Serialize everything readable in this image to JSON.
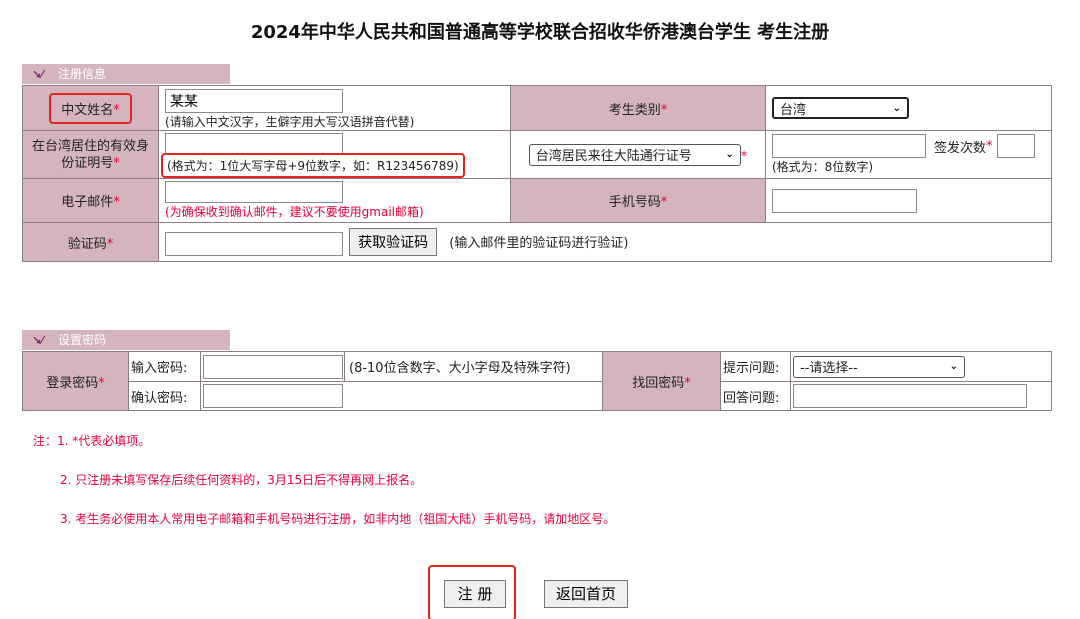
{
  "title": "2024年中华人民共和国普通高等学校联合招收华侨港澳台学生  考生注册",
  "section1": {
    "tab": "注册信息",
    "name_label": "中文姓名",
    "name_value": "某某",
    "name_hint": "(请输入中文汉字，生僻字用大写汉语拼音代替)",
    "category_label": "考生类别",
    "category_value": "台湾",
    "id_label": "在台湾居住的有效身份证明号",
    "id_hint": "(格式为：1位大写字母+9位数字，如：R123456789)",
    "permit_type": "台湾居民来往大陆通行证号",
    "permit_hint": "(格式为：8位数字)",
    "issue_count_label": "签发次数",
    "email_label": "电子邮件",
    "email_hint": "(为确保收到确认邮件，建议不要使用gmail邮箱)",
    "phone_label": "手机号码",
    "code_label": "验证码",
    "code_button": "获取验证码",
    "code_hint": "(输入邮件里的验证码进行验证)",
    "required_mark": "*"
  },
  "section2": {
    "tab": "设置密码",
    "login_pwd_label": "登录密码",
    "enter_pwd_label": "输入密码:",
    "enter_pwd_hint": "(8-10位含数字、大小字母及特殊字符)",
    "confirm_pwd_label": "确认密码:",
    "recover_label": "找回密码",
    "question_label": "提示问题:",
    "question_value": "--请选择--",
    "answer_label": "回答问题:"
  },
  "notes": [
    "注：1. *代表必填项。",
    "2. 只注册未填写保存后续任何资料的，3月15日后不得再网上报名。",
    "3. 考生务必使用本人常用电子邮箱和手机号码进行注册，如非内地（祖国大陆）手机号码，请加地区号。"
  ],
  "buttons": {
    "register": "注 册",
    "back": "返回首页"
  },
  "colors": {
    "label_bg": "#d4b5bd",
    "required": "#e4003a",
    "highlight": "#e1261f"
  }
}
